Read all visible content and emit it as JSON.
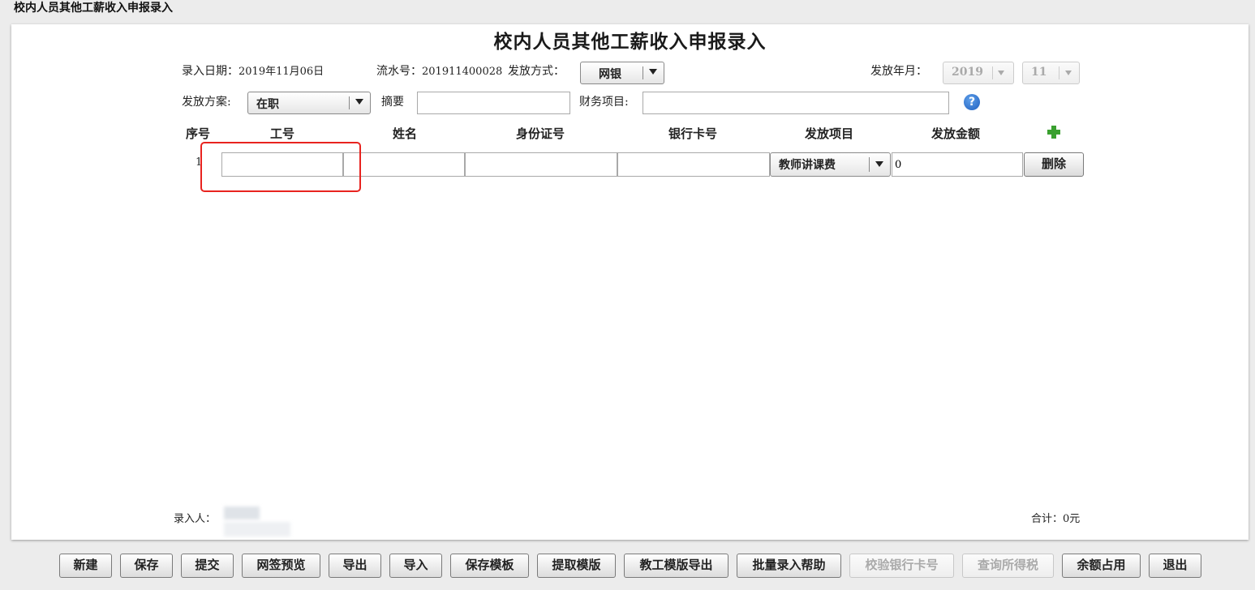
{
  "window": {
    "title": "校内人员其他工薪收入申报录入"
  },
  "form": {
    "title": "校内人员其他工薪收入申报录入",
    "entry_date_label": "录入日期：",
    "entry_date": "2019年11月06日",
    "serial_label": "流水号：",
    "serial_no": "201911400028",
    "pay_method_label": "发放方式：",
    "pay_method": "网银",
    "pay_month_label": "发放年月：",
    "pay_year": "2019",
    "pay_month": "11",
    "plan_label": "发放方案:",
    "plan": "在职",
    "summary_label": "摘要",
    "summary_value": "",
    "finance_label": "财务项目:",
    "finance_value": "",
    "help_icon": "?"
  },
  "table": {
    "headers": [
      "序号",
      "工号",
      "姓名",
      "身份证号",
      "银行卡号",
      "发放项目",
      "发放金额"
    ],
    "rows": [
      {
        "index": "1",
        "staff_no": "",
        "name": "",
        "id_no": "",
        "bank_card": "",
        "item": "教师讲课费",
        "amount": "0",
        "delete_label": "删除"
      }
    ]
  },
  "footer": {
    "entered_by_label": "录入人：",
    "total_label": "合计：",
    "total_value": "0元"
  },
  "toolbar": {
    "buttons": [
      "新建",
      "保存",
      "提交",
      "网签预览",
      "导出",
      "导入",
      "保存模板",
      "提取模版",
      "教工模版导出",
      "批量录入帮助",
      "校验银行卡号",
      "查询所得税",
      "余额占用",
      "退出"
    ]
  },
  "colors": {
    "highlight": "#e8231f",
    "add_icon": "#3aa02f",
    "help_icon": "#1f5fbf"
  },
  "icons": {
    "add": "plus-icon",
    "help": "help-icon",
    "dropdown": "chevron-down-icon"
  }
}
